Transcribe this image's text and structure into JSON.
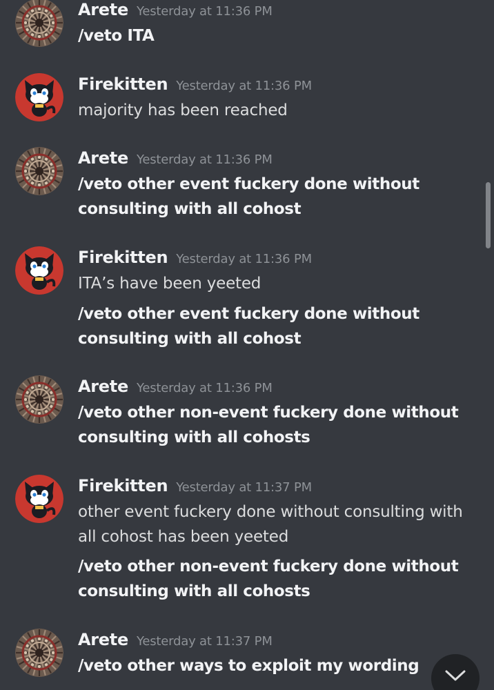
{
  "users": {
    "arete": {
      "name": "Arete",
      "avatar": "mandala-avatar"
    },
    "firekitten": {
      "name": "Firekitten",
      "avatar": "black-cat-avatar"
    }
  },
  "messages": [
    {
      "author": "Arete",
      "time": "Yesterday at 11:36 PM",
      "lines": [
        {
          "text": "/veto ITA",
          "bold": true
        }
      ]
    },
    {
      "author": "Firekitten",
      "time": "Yesterday at 11:36 PM",
      "lines": [
        {
          "text": "majority has been reached",
          "bold": false
        }
      ]
    },
    {
      "author": "Arete",
      "time": "Yesterday at 11:36 PM",
      "lines": [
        {
          "text": "/veto other event fuckery done without",
          "bold": true
        },
        {
          "text": "consulting with all cohost",
          "bold": true
        }
      ]
    },
    {
      "author": "Firekitten",
      "time": "Yesterday at 11:36 PM",
      "lines": [
        {
          "text": "ITA’s have been yeeted",
          "bold": false
        },
        {
          "text": "/veto other event fuckery done without",
          "bold": true
        },
        {
          "text": "consulting with all cohost",
          "bold": true
        }
      ]
    },
    {
      "author": "Arete",
      "time": "Yesterday at 11:36 PM",
      "lines": [
        {
          "text": "/veto other non-event fuckery done without",
          "bold": true
        },
        {
          "text": "consulting with all cohosts",
          "bold": true
        }
      ]
    },
    {
      "author": "Firekitten",
      "time": "Yesterday at 11:37 PM",
      "lines": [
        {
          "text": "other event fuckery done without consulting with",
          "bold": false
        },
        {
          "text": "all cohost has been yeeted",
          "bold": false
        },
        {
          "text": "/veto other non-event fuckery done without",
          "bold": true
        },
        {
          "text": "consulting with all cohosts",
          "bold": true
        }
      ]
    },
    {
      "author": "Arete",
      "time": "Yesterday at 11:37 PM",
      "lines": [
        {
          "text": "/veto other ways to exploit my wording",
          "bold": true
        }
      ]
    }
  ],
  "icons": {
    "jump": "chevron-down-icon"
  },
  "colors": {
    "background": "#36393f",
    "username": "#f2f3f5",
    "timestamp": "#8e9297",
    "text": "#dcddde",
    "jump_button": "#202225"
  }
}
